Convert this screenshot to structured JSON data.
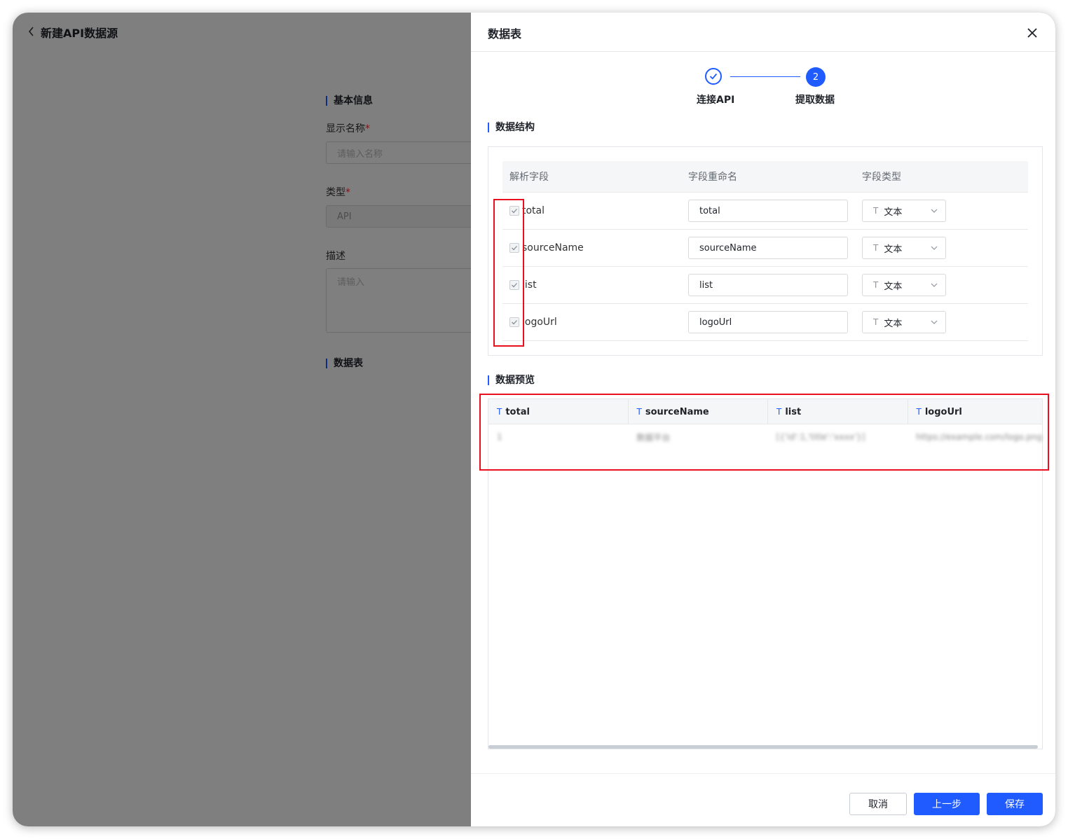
{
  "bg": {
    "title": "新建API数据源",
    "section_basic": "基本信息",
    "name_label": "显示名称",
    "name_placeholder": "请输入名称",
    "type_label": "类型",
    "type_value": "API",
    "desc_label": "描述",
    "desc_placeholder": "请输入",
    "section_table": "数据表",
    "required_mark": "*"
  },
  "drawer": {
    "title": "数据表",
    "steps": [
      {
        "label": "连接API",
        "state": "done"
      },
      {
        "label": "提取数据",
        "state": "active",
        "number": "2"
      }
    ]
  },
  "structure": {
    "title": "数据结构",
    "columns": [
      "解析字段",
      "字段重命名",
      "字段类型"
    ],
    "rows": [
      {
        "field": "total",
        "rename": "total",
        "type": "文本",
        "checked": true
      },
      {
        "field": "sourceName",
        "rename": "sourceName",
        "type": "文本",
        "checked": true
      },
      {
        "field": "list",
        "rename": "list",
        "type": "文本",
        "checked": true
      },
      {
        "field": "logoUrl",
        "rename": "logoUrl",
        "type": "文本",
        "checked": true
      }
    ],
    "type_icon": "T"
  },
  "preview": {
    "title": "数据预览",
    "columns": [
      "total",
      "sourceName",
      "list",
      "logoUrl"
    ],
    "type_icon": "T",
    "row": [
      "1",
      "数据平台",
      "[{'id':1,'title':'xxxx'}]",
      "https://example.com/logo.png"
    ]
  },
  "footer": {
    "cancel": "取消",
    "prev": "上一步",
    "save": "保存"
  },
  "colors": {
    "accent": "#1f5bff",
    "highlight": "#e8101e"
  }
}
